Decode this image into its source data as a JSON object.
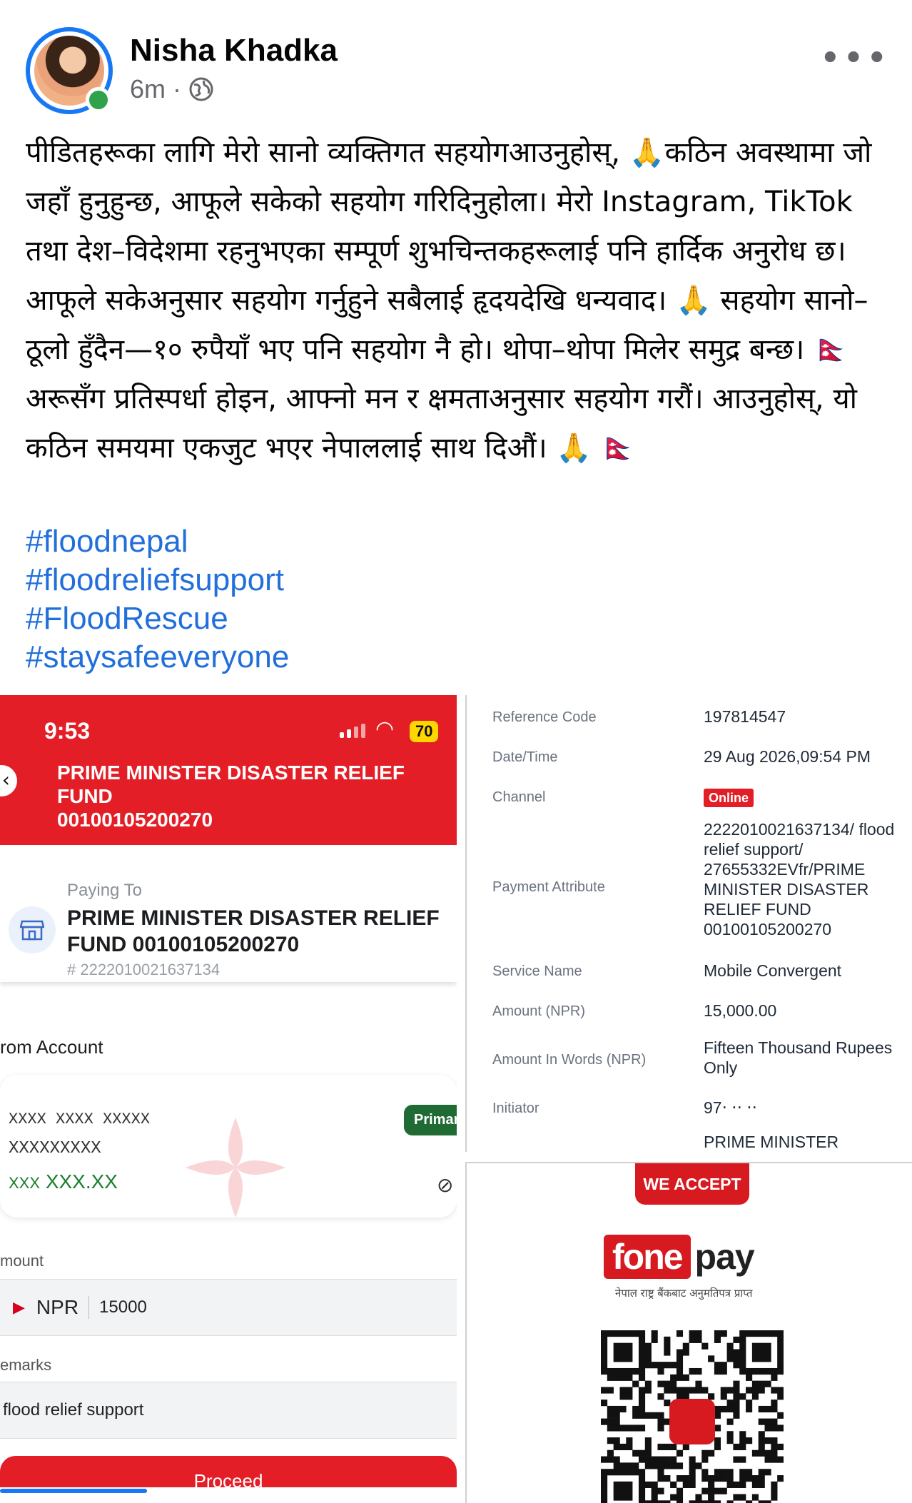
{
  "post": {
    "author": "Nisha Khadka",
    "time": "6m",
    "separator": "·",
    "more": "•••",
    "text": "पीडितहरूका लागि मेरो सानो व्यक्तिगत सहयोगआउनुहोस्, 🙏कठिन अवस्थामा जो जहाँ हुनुहुन्छ, आफूले सकेको सहयोग गरिदिनुहोला। मेरो Instagram, TikTok तथा देश–विदेशमा रहनुभएका सम्पूर्ण शुभचिन्तकहरूलाई पनि हार्दिक अनुरोध छ। आफूले सकेअनुसार सहयोग गर्नुहुने सबैलाई हृदयदेखि धन्यवाद। 🙏 सहयोग सानो–ठूलो हुँदैन—१० रुपैयाँ भए पनि सहयोग नै हो। थोपा–थोपा मिलेर समुद्र बन्छ। 🇳🇵 अरूसँग प्रतिस्पर्धा होइन, आफ्नो मन र क्षमताअनुसार सहयोग गरौं। आउनुहोस्, यो कठिन समयमा एकजुट भएर नेपाललाई साथ दिऔं। 🙏 🇳🇵",
    "hashtags": [
      "#floodnepal",
      "#floodreliefsupport",
      "#FloodRescue",
      "#staysafeeveryone"
    ]
  },
  "payment_screen": {
    "status_time": "9:53",
    "battery": "70",
    "header_title_line1": "PRIME MINISTER DISASTER RELIEF FUND",
    "header_title_line2": "00100105200270",
    "paying_to_label": "Paying To",
    "paying_to_name": "PRIME MINISTER DISASTER RELIEF FUND 00100105200270",
    "paying_to_id": "# 2222010021637134",
    "from_account_label": "rom Account",
    "account_line1": "XXXX XXXX XXXXX",
    "account_line2": "XXXXXXXXX",
    "balance_prefix": "XXX",
    "balance": "XXX.XX",
    "primary_badge": "Primar",
    "amount_label": "mount",
    "currency": "NPR",
    "amount_value": "15000",
    "remarks_label": "emarks",
    "remarks_value": "flood relief support",
    "proceed_label": "Proceed"
  },
  "receipt": {
    "rows": [
      {
        "label": "Reference Code",
        "value": "197814547"
      },
      {
        "label": "Date/Time",
        "value": "29 Aug 2026,09:54 PM"
      },
      {
        "label": "Channel",
        "value": "Online"
      },
      {
        "label": "Payment Attribute",
        "value": "2222010021637134/ flood relief support/ 27655332EVfr/PRIME MINISTER DISASTER RELIEF FUND 00100105200270"
      },
      {
        "label": "Service Name",
        "value": "Mobile Convergent"
      },
      {
        "label": "Amount (NPR)",
        "value": "15,000.00"
      },
      {
        "label": "Amount In Words (NPR)",
        "value": "Fifteen Thousand Rupees Only"
      },
      {
        "label": "Initiator",
        "value": "97‧ ‧‧ ‧‧"
      },
      {
        "label": "",
        "value": "PRIME MINISTER"
      }
    ]
  },
  "fonepay": {
    "we_accept": "WE ACCEPT",
    "brand_part1": "fone",
    "brand_part2": "pay",
    "subtitle": "नेपाल राष्ट्र बैंकबाट अनुमतिपत्र प्राप्त"
  },
  "colors": {
    "fb_blue": "#1877f2",
    "hashtag": "#216fdb",
    "bank_red": "#e41e26",
    "online_green": "#31a24c"
  }
}
